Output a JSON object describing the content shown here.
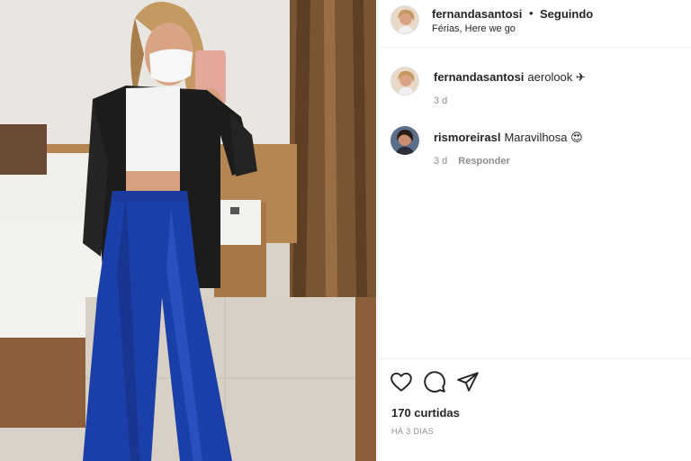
{
  "post": {
    "photo_alt": "",
    "header": {
      "username": "fernandasantosi",
      "separator": "•",
      "follow_label": "Seguindo",
      "location": "Férias, Here we go"
    },
    "comments": [
      {
        "username": "fernandasantosi",
        "text": "aerolook ✈",
        "age": "3 d",
        "reply_label": ""
      },
      {
        "username": "rismoreirasl",
        "text": "Maravilhosa 😍",
        "age": "3 d",
        "reply_label": "Responder"
      }
    ],
    "actions": {
      "like_icon": "heart-icon",
      "comment_icon": "comment-bubble-icon",
      "share_icon": "paper-plane-icon"
    },
    "likes_text": "170 curtidas",
    "time_ago": "HÁ 3 DIAS"
  },
  "colors": {
    "text_primary": "#262626",
    "text_secondary": "#8e8e8e",
    "border": "#efefef",
    "jacket": "#1c1c1c",
    "pants": "#1b3fa8"
  }
}
